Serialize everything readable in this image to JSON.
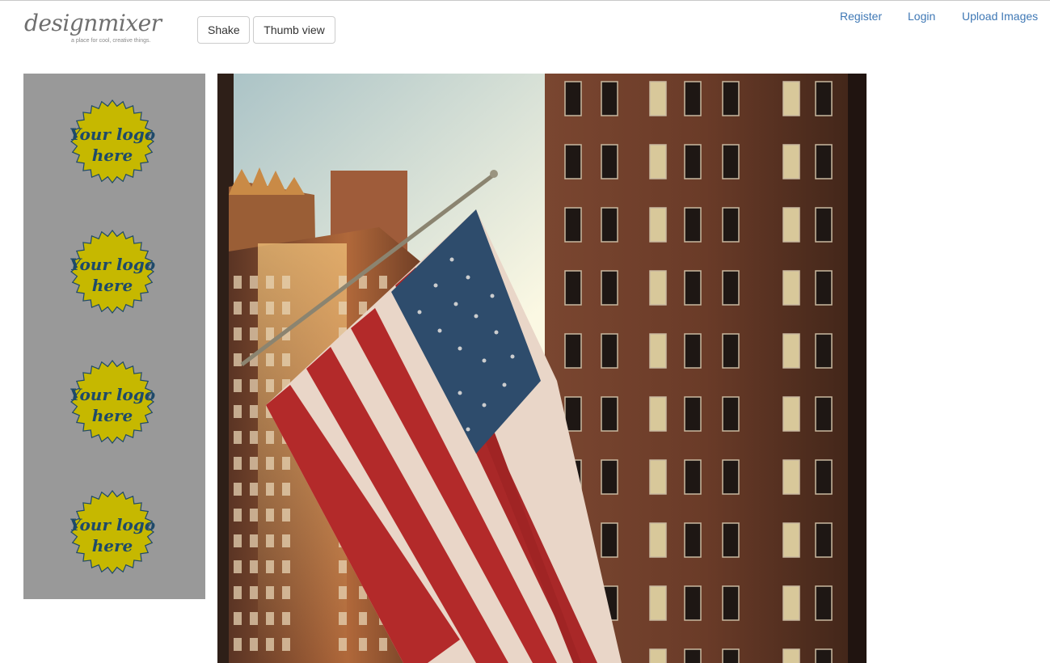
{
  "brand": {
    "name": "designmixer",
    "tagline": "a place for cool, creative things."
  },
  "toolbar": {
    "shake_label": "Shake",
    "thumb_label": "Thumb view"
  },
  "nav": {
    "register": "Register",
    "login": "Login",
    "upload": "Upload Images"
  },
  "sidebar": {
    "ads": [
      {
        "line1": "Your logo",
        "line2": "here"
      },
      {
        "line1": "Your logo",
        "line2": "here"
      },
      {
        "line1": "Your logo",
        "line2": "here"
      },
      {
        "line1": "Your logo",
        "line2": "here"
      }
    ]
  },
  "colors": {
    "link": "#3f78b5",
    "sidebar_bg": "#999999",
    "badge_fill": "#c6b800",
    "badge_text": "#1e4a6a"
  }
}
